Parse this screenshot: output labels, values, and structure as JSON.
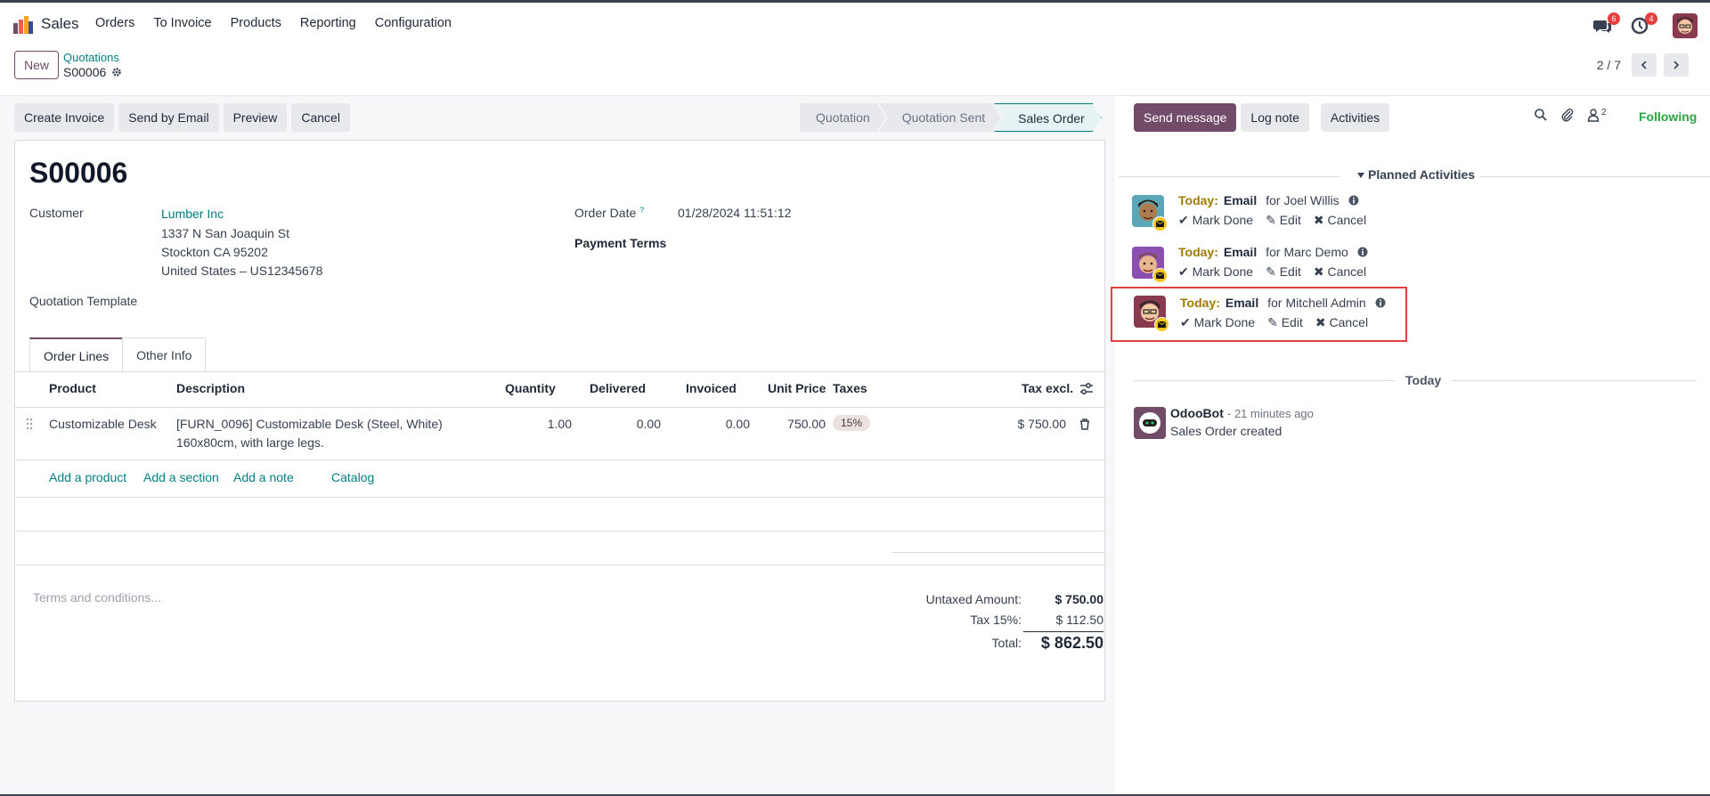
{
  "app": {
    "name": "Sales"
  },
  "nav": {
    "menus": [
      "Orders",
      "To Invoice",
      "Products",
      "Reporting",
      "Configuration"
    ]
  },
  "systray": {
    "messages_badge": "6",
    "activities_badge": "4"
  },
  "control_panel": {
    "new_label": "New",
    "breadcrumb_parent": "Quotations",
    "breadcrumb_current": "S00006",
    "pager": "2 / 7"
  },
  "actions": {
    "buttons": [
      "Create Invoice",
      "Send by Email",
      "Preview",
      "Cancel"
    ]
  },
  "status": {
    "stages": [
      "Quotation",
      "Quotation Sent",
      "Sales Order"
    ],
    "active": "Sales Order"
  },
  "form": {
    "title": "S00006",
    "customer_label": "Customer",
    "customer_name": "Lumber Inc",
    "customer_address": [
      "1337 N San Joaquin St",
      "Stockton CA 95202",
      "United States – US12345678"
    ],
    "template_label": "Quotation Template",
    "order_date_label": "Order Date",
    "order_date_tip": "?",
    "order_date": "01/28/2024 11:51:12",
    "payment_terms_label": "Payment Terms"
  },
  "tabs": [
    "Order Lines",
    "Other Info"
  ],
  "lines": {
    "headers": {
      "product": "Product",
      "description": "Description",
      "quantity": "Quantity",
      "delivered": "Delivered",
      "invoiced": "Invoiced",
      "unit_price": "Unit Price",
      "taxes": "Taxes",
      "tax_excl": "Tax excl."
    },
    "rows": [
      {
        "product": "Customizable Desk",
        "description_1": "[FURN_0096] Customizable Desk (Steel, White)",
        "description_2": "160x80cm, with large legs.",
        "quantity": "1.00",
        "delivered": "0.00",
        "invoiced": "0.00",
        "unit_price": "750.00",
        "tax": "15%",
        "subtotal": "$ 750.00"
      }
    ],
    "add_links": [
      "Add a product",
      "Add a section",
      "Add a note",
      "Catalog"
    ]
  },
  "terms_placeholder": "Terms and conditions...",
  "totals": {
    "untaxed_label": "Untaxed Amount:",
    "untaxed": "$ 750.00",
    "tax_label": "Tax 15%:",
    "tax": "$ 112.50",
    "total_label": "Total:",
    "total": "$ 862.50"
  },
  "chatter": {
    "send_message": "Send message",
    "log_note": "Log note",
    "activities": "Activities",
    "followers_count": "2",
    "following": "Following",
    "planned_title": "Planned Activities",
    "activities_list": [
      {
        "when": "Today:",
        "type": "Email",
        "for": "for Joel Willis"
      },
      {
        "when": "Today:",
        "type": "Email",
        "for": "for Marc Demo"
      },
      {
        "when": "Today:",
        "type": "Email",
        "for": "for Mitchell Admin"
      }
    ],
    "activity_actions": {
      "mark_done": "Mark Done",
      "edit": "Edit",
      "cancel": "Cancel"
    },
    "today_separator": "Today",
    "message": {
      "author": "OdooBot",
      "time": "- 21 minutes ago",
      "body": "Sales Order created"
    }
  },
  "colors": {
    "brand": "#714b67",
    "link": "#017e84",
    "following": "#28a745",
    "highlight": "#e53e3e"
  }
}
